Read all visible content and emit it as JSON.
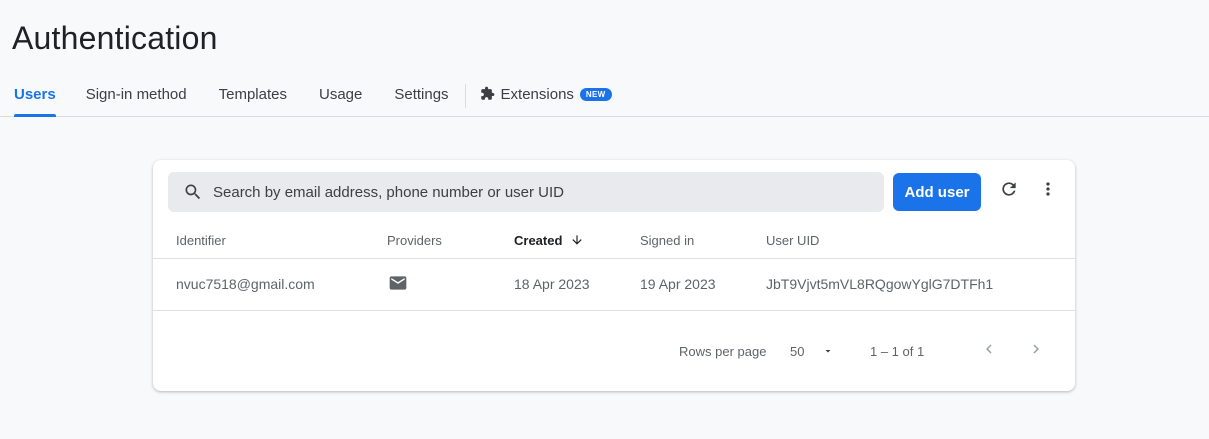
{
  "header": {
    "title": "Authentication",
    "tabs": [
      {
        "label": "Users",
        "active": true
      },
      {
        "label": "Sign-in method",
        "active": false
      },
      {
        "label": "Templates",
        "active": false
      },
      {
        "label": "Usage",
        "active": false
      },
      {
        "label": "Settings",
        "active": false
      }
    ],
    "extensions_tab": {
      "label": "Extensions",
      "badge": "NEW",
      "icon": "puzzle-icon"
    }
  },
  "toolbar": {
    "search_placeholder": "Search by email address, phone number or user UID",
    "search_value": "",
    "add_user_label": "Add user",
    "refresh_icon": "refresh-icon",
    "more_icon": "more-vert-icon"
  },
  "table": {
    "columns": {
      "identifier": "Identifier",
      "providers": "Providers",
      "created": "Created",
      "signed_in": "Signed in",
      "user_uid": "User UID"
    },
    "sort": {
      "column": "Created",
      "direction": "descending"
    },
    "rows": [
      {
        "identifier": "nvuc7518@gmail.com",
        "provider_icon": "email-icon",
        "created": "18 Apr 2023",
        "signed_in": "19 Apr 2023",
        "user_uid": "JbT9Vjvt5mVL8RQgowYglG7DTFh1"
      }
    ]
  },
  "pagination": {
    "rows_per_page_label": "Rows per page",
    "rows_per_page_value": "50",
    "range_text": "1 – 1 of 1"
  },
  "colors": {
    "accent": "#1a73e8",
    "background": "#f8f9fa",
    "card": "#ffffff"
  }
}
